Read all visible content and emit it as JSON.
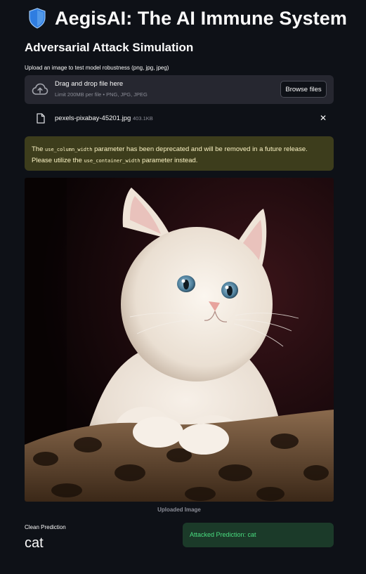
{
  "header": {
    "icon": "shield-icon",
    "title": "AegisAI: The AI Immune System"
  },
  "section": {
    "title": "Adversarial Attack Simulation"
  },
  "uploader": {
    "label": "Upload an image to test model robustness (png, jpg, jpeg)",
    "drop_text": "Drag and drop file here",
    "limit_text": "Limit 200MB per file • PNG, JPG, JPEG",
    "browse_label": "Browse files",
    "icon": "cloud-upload-icon",
    "file": {
      "name": "pexels-pixabay-45201.jpg",
      "size": "403.1KB",
      "icon": "file-icon",
      "remove_icon": "close-icon",
      "remove_glyph": "✕"
    }
  },
  "warning": {
    "pre": "The ",
    "code1": "use_column_width",
    "mid": " parameter has been deprecated and will be removed in a future release. Please utilize the ",
    "code2": "use_container_width",
    "post": " parameter instead."
  },
  "image": {
    "caption": "Uploaded Image"
  },
  "results": {
    "clean_label": "Clean Prediction",
    "clean_value": "cat",
    "attacked_text": "Attacked Prediction: cat"
  },
  "colors": {
    "background": "#0e1117",
    "panel": "#262730",
    "warning_bg": "#3d3d1c",
    "warning_text": "#fbf3c4",
    "success_bg": "#1b3a29",
    "success_text": "#4ade80",
    "shield": "#2f7de1"
  }
}
